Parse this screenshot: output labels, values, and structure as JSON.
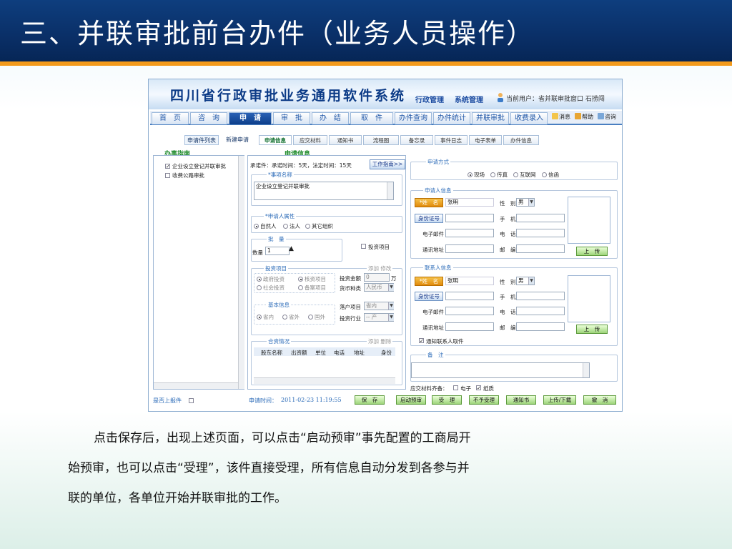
{
  "slide": {
    "title": "三、并联审批前台办件（业务人员操作）",
    "caption_lines": [
      "点击保存后，出现上述页面，可以点击“启动预审”事先配置的工商局开",
      "始预审，也可以点击“受理”，该件直接受理，所有信息自动分发到各参与并",
      "联的单位，各单位开始并联审批的工作。"
    ]
  },
  "app": {
    "title": "四川省行政审批业务通用软件系统",
    "top_links": [
      "行政管理",
      "系统管理"
    ],
    "current_user": "当前用户：省并联审批窗口  石捞闯",
    "nav_tabs": [
      "首　页",
      "咨　询",
      "申　请",
      "审　批",
      "办　结",
      "取　件",
      "办件查询",
      "办件统计",
      "并联审批",
      "收费录入"
    ],
    "active_nav": "申　请",
    "utility_links": [
      "消息",
      "帮助",
      "咨询"
    ],
    "sub_tabs": [
      "申请件列表",
      "新建申请"
    ],
    "doc_tabs": [
      "申请信息",
      "应交材料",
      "通知书",
      "流程图",
      "备忘录",
      "事件日志",
      "电子表单",
      "办件信息"
    ],
    "active_doc_tab": "申请信息"
  },
  "guide": {
    "title": "办事指南",
    "items": [
      {
        "label": "企业设立登记并联审批",
        "checked": true
      },
      {
        "label": "收费公路审批",
        "checked": false
      }
    ]
  },
  "apply": {
    "title": "申请信息",
    "deadline": "承诺件：承诺时间：5天，法定时间：15天",
    "guide_button": "工作指南>>",
    "item_name_label": "*事项名称",
    "item_name_value": "企业设立登记并联审批",
    "attr_label": "*申请人属性",
    "attr_options": [
      "自然人",
      "法人",
      "其它组织"
    ],
    "attr_selected": "自然人",
    "batch_label": "批　量",
    "qty_label": "数量",
    "qty_value": "1",
    "invest_checkbox": "投资项目",
    "invest_legend": "投资项目",
    "invest_actions": "添加 修改",
    "invest_types": [
      "政府投资",
      "社会投资"
    ],
    "invest_modes": [
      "核资项目",
      "备案项目"
    ],
    "invest_amount_label": "投资金额",
    "invest_amount_value": "0",
    "invest_amount_unit": "万",
    "currency_label": "货币种类",
    "currency_value": "人民币",
    "basic_legend": "基本信息",
    "region_options": [
      "省内",
      "省外",
      "国外"
    ],
    "land_label": "落户项目",
    "land_value": "省内",
    "industry_label": "投资行业",
    "industry_value": "-- 产",
    "partner_legend": "合资情况",
    "partner_actions": "添加 删除",
    "partner_columns": [
      "股东名称",
      "出资额",
      "单位",
      "电话",
      "地址",
      "身份"
    ]
  },
  "method": {
    "legend": "申请方式",
    "options": [
      "现场",
      "传真",
      "互联网",
      "信函"
    ],
    "selected": "现场"
  },
  "applicant": {
    "legend": "申请人信息",
    "name_button": "*姓　名",
    "name_value": "张明",
    "gender_label": "性　别",
    "gender_value": "男",
    "id_button": "身份证号",
    "phone_label": "手　机",
    "email_label": "电子邮件",
    "tel_label": "电　话",
    "address_label": "通讯地址",
    "zip_label": "邮　编",
    "upload_button": "上　传"
  },
  "contact": {
    "legend": "联系人信息",
    "name_button": "*姓　名",
    "name_value": "张明",
    "gender_label": "性　别",
    "gender_value": "男",
    "id_button": "身份证号",
    "phone_label": "手　机",
    "email_label": "电子邮件",
    "tel_label": "电　话",
    "address_label": "通讯地址",
    "zip_label": "邮　编",
    "upload_button": "上　传",
    "notify_checkbox": "通知联系人取件"
  },
  "remark": {
    "legend": "备　注",
    "materials_label": "应交材料齐备：",
    "materials": [
      {
        "label": "电子",
        "checked": false
      },
      {
        "label": "纸质",
        "checked": true
      }
    ]
  },
  "footer": {
    "online_label": "是否上报件",
    "time_label": "申请时间：",
    "time_value": "2011-02-23 11:19:55",
    "buttons": [
      "保　存",
      "启动预审",
      "受　理",
      "不予受理",
      "通知书",
      "上传/下载",
      "撤　消"
    ]
  }
}
